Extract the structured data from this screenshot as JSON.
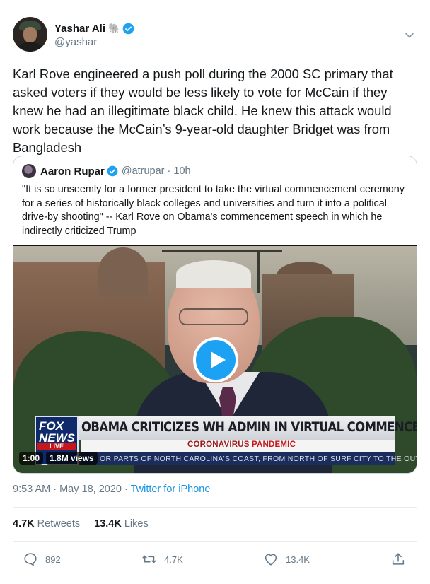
{
  "author": {
    "display_name": "Yashar Ali",
    "emoji": "🐘",
    "handle": "@yashar"
  },
  "tweet": {
    "text": "Karl Rove engineered a push poll during the 2000 SC primary that asked voters if they would be less likely to vote for McCain if they knew he had an illegitimate black child. He knew this attack would work because the McCain’s 9-year-old daughter Bridget was from Bangladesh"
  },
  "quoted": {
    "display_name": "Aaron Rupar",
    "handle_time": "@atrupar · 10h",
    "text": "\"It is so unseemly for a former president to take the virtual commencement ceremony for a series of historically black colleges and universities and turn it into a political drive-by shooting\" -- Karl Rove on Obama's commencement speech in which he indirectly criticized Trump",
    "video": {
      "headline": "OBAMA CRITICIZES WH ADMIN IN VIRTUAL COMMENCEMENT",
      "subhead_prefix": "CORONAVIRUS ",
      "subhead_accent": "PANDEMIC",
      "ticker": "OR PARTS OF NORTH CAROLINA'S COAST, FROM NORTH OF SURF CITY TO THE OUTER-",
      "logo_text": "FOX NEWS",
      "live_label": "LIVE",
      "duration": "1:00",
      "views": "1.8M views"
    }
  },
  "meta": {
    "time": "9:53 AM · May 18, 2020 · ",
    "source": "Twitter for iPhone"
  },
  "stats": {
    "retweets_count": "4.7K",
    "retweets_label": "Retweets",
    "likes_count": "13.4K",
    "likes_label": "Likes"
  },
  "actions": {
    "reply_count": "892",
    "retweet_count": "4.7K",
    "like_count": "13.4K"
  },
  "colors": {
    "accent": "#1da1f2",
    "link": "#1b95e0",
    "text_secondary": "#657786"
  }
}
